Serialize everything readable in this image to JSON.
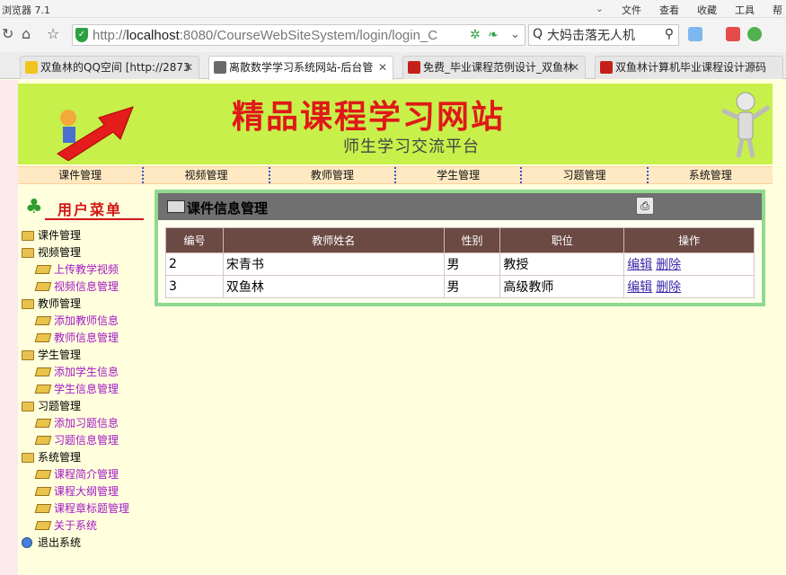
{
  "browser": {
    "app_title": "浏览器 7.1",
    "menus": [
      "文件",
      "查看",
      "收藏",
      "工具",
      "帮"
    ],
    "address": {
      "prefix": "http://",
      "host": "localhost",
      "rest": ":8080/CourseWebSiteSystem/login/login_C"
    },
    "search": {
      "value": "大妈击落无人机"
    },
    "tabs": [
      {
        "label": "双鱼林的QQ空间 [http://2873",
        "active": false
      },
      {
        "label": "离散数学学习系统网站-后台管",
        "active": true
      },
      {
        "label": "免费_毕业课程范例设计_双鱼林",
        "active": false
      },
      {
        "label": "双鱼林计算机毕业课程设计源码",
        "active": false
      }
    ]
  },
  "banner": {
    "title": "精品课程学习网站",
    "subtitle": "师生学习交流平台"
  },
  "nav": {
    "items": [
      "课件管理",
      "视频管理",
      "教师管理",
      "学生管理",
      "习题管理",
      "系统管理"
    ]
  },
  "sidebar": {
    "header": "用户菜单",
    "groups": [
      {
        "label": "课件管理",
        "items": []
      },
      {
        "label": "视频管理",
        "items": [
          "上传教学视频",
          "视频信息管理"
        ]
      },
      {
        "label": "教师管理",
        "items": [
          "添加教师信息",
          "教师信息管理"
        ]
      },
      {
        "label": "学生管理",
        "items": [
          "添加学生信息",
          "学生信息管理"
        ]
      },
      {
        "label": "习题管理",
        "items": [
          "添加习题信息",
          "习题信息管理"
        ]
      },
      {
        "label": "系统管理",
        "items": [
          "课程简介管理",
          "课程大纲管理",
          "课程章标题管理",
          "关于系统"
        ]
      }
    ],
    "logout": "退出系统"
  },
  "panel": {
    "title": "课件信息管理",
    "columns": [
      "编号",
      "教师姓名",
      "性别",
      "职位",
      "操作"
    ],
    "rows": [
      {
        "id": "2",
        "name": "宋青书",
        "gender": "男",
        "title": "教授"
      },
      {
        "id": "3",
        "name": "双鱼林",
        "gender": "男",
        "title": "高级教师"
      }
    ],
    "edit_label": "编辑",
    "delete_label": "删除"
  },
  "colors": {
    "banner_bg": "#c7f04a",
    "banner_title": "#e01818",
    "table_header": "#6b4a44",
    "panel_border": "#8fd98f",
    "submenu_text": "#a21ac7"
  }
}
